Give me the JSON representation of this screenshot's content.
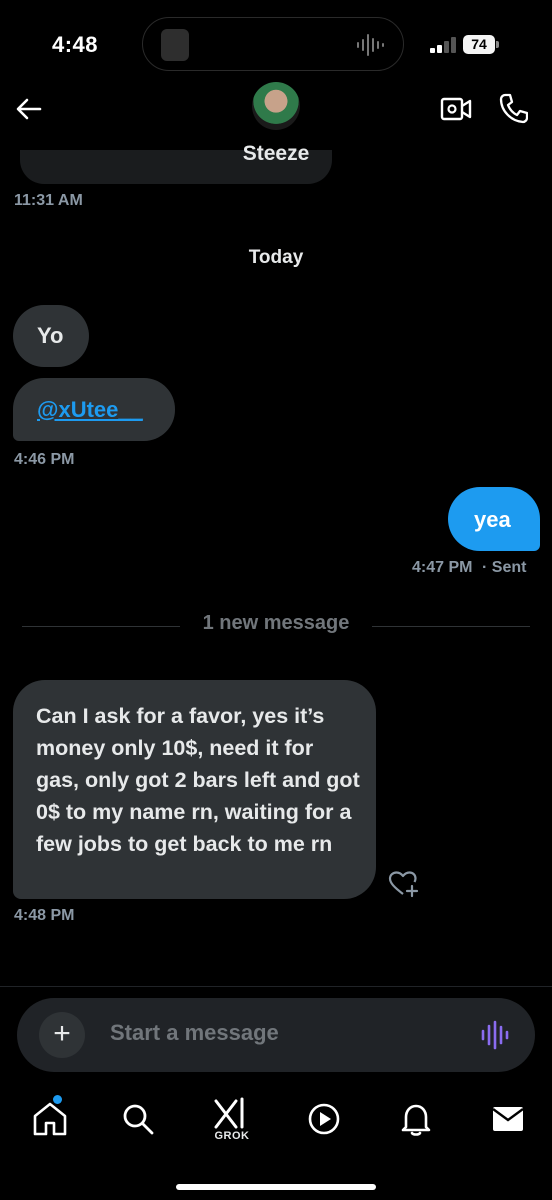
{
  "status_bar": {
    "time": "4:48",
    "battery": "74"
  },
  "header": {
    "contact_name": "Steeze"
  },
  "conversation": {
    "prev_timestamp": "11:31 AM",
    "day_separator": "Today",
    "messages_in_1": [
      "Yo"
    ],
    "mention": "@xUtee__",
    "timestamp_in_1": "4:46 PM",
    "outgoing": "yea",
    "timestamp_out": "4:47 PM",
    "status_out": "· Sent",
    "new_divider": "1 new message",
    "long_message": "Can I ask for a favor, yes it’s money only 10$, need it for gas, only got 2 bars left and got 0$ to my name rn, waiting for a few jobs to get back to me rn",
    "timestamp_in_2": "4:48 PM"
  },
  "composer": {
    "placeholder": "Start a message"
  },
  "tabbar": {
    "grok_label": "GROK"
  },
  "colors": {
    "accent": "#1d9bf0",
    "bubble_in": "#2f3336",
    "background": "#000000",
    "muted": "#71767b"
  },
  "icons": [
    "back-arrow-icon",
    "video-call-icon",
    "phone-icon",
    "heart-plus-icon",
    "plus-icon",
    "voice-wave-icon",
    "home-icon",
    "search-icon",
    "grok-icon",
    "play-icon",
    "bell-icon",
    "mail-icon"
  ]
}
